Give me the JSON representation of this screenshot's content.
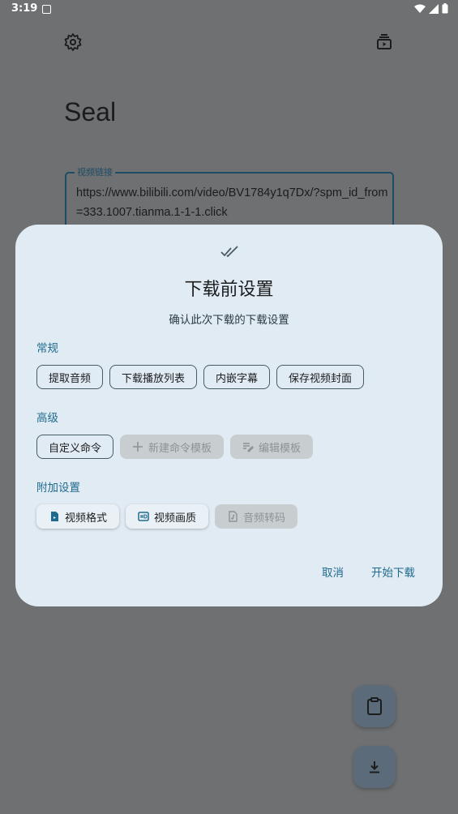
{
  "status_bar": {
    "time": "3:19"
  },
  "app": {
    "title": "Seal",
    "url_field": {
      "label": "视频链接",
      "value": "https://www.bilibili.com/video/BV1784y1q7Dx/?spm_id_from=333.1007.tianma.1-1-1.click"
    }
  },
  "dialog": {
    "title": "下载前设置",
    "subtitle": "确认此次下载的下载设置",
    "sections": {
      "general": {
        "label": "常规",
        "chips": [
          "提取音频",
          "下载播放列表",
          "内嵌字幕",
          "保存视频封面"
        ]
      },
      "advanced": {
        "label": "高级",
        "chips": [
          "自定义命令",
          "新建命令模板",
          "编辑模板"
        ]
      },
      "extra": {
        "label": "附加设置",
        "chips": [
          "视频格式",
          "视频画质",
          "音频转码"
        ]
      }
    },
    "actions": {
      "cancel": "取消",
      "confirm": "开始下载"
    }
  },
  "colors": {
    "accent": "#1f6a8e",
    "dialog_bg": "#e1ebf3",
    "scrim": "#6f7072"
  }
}
